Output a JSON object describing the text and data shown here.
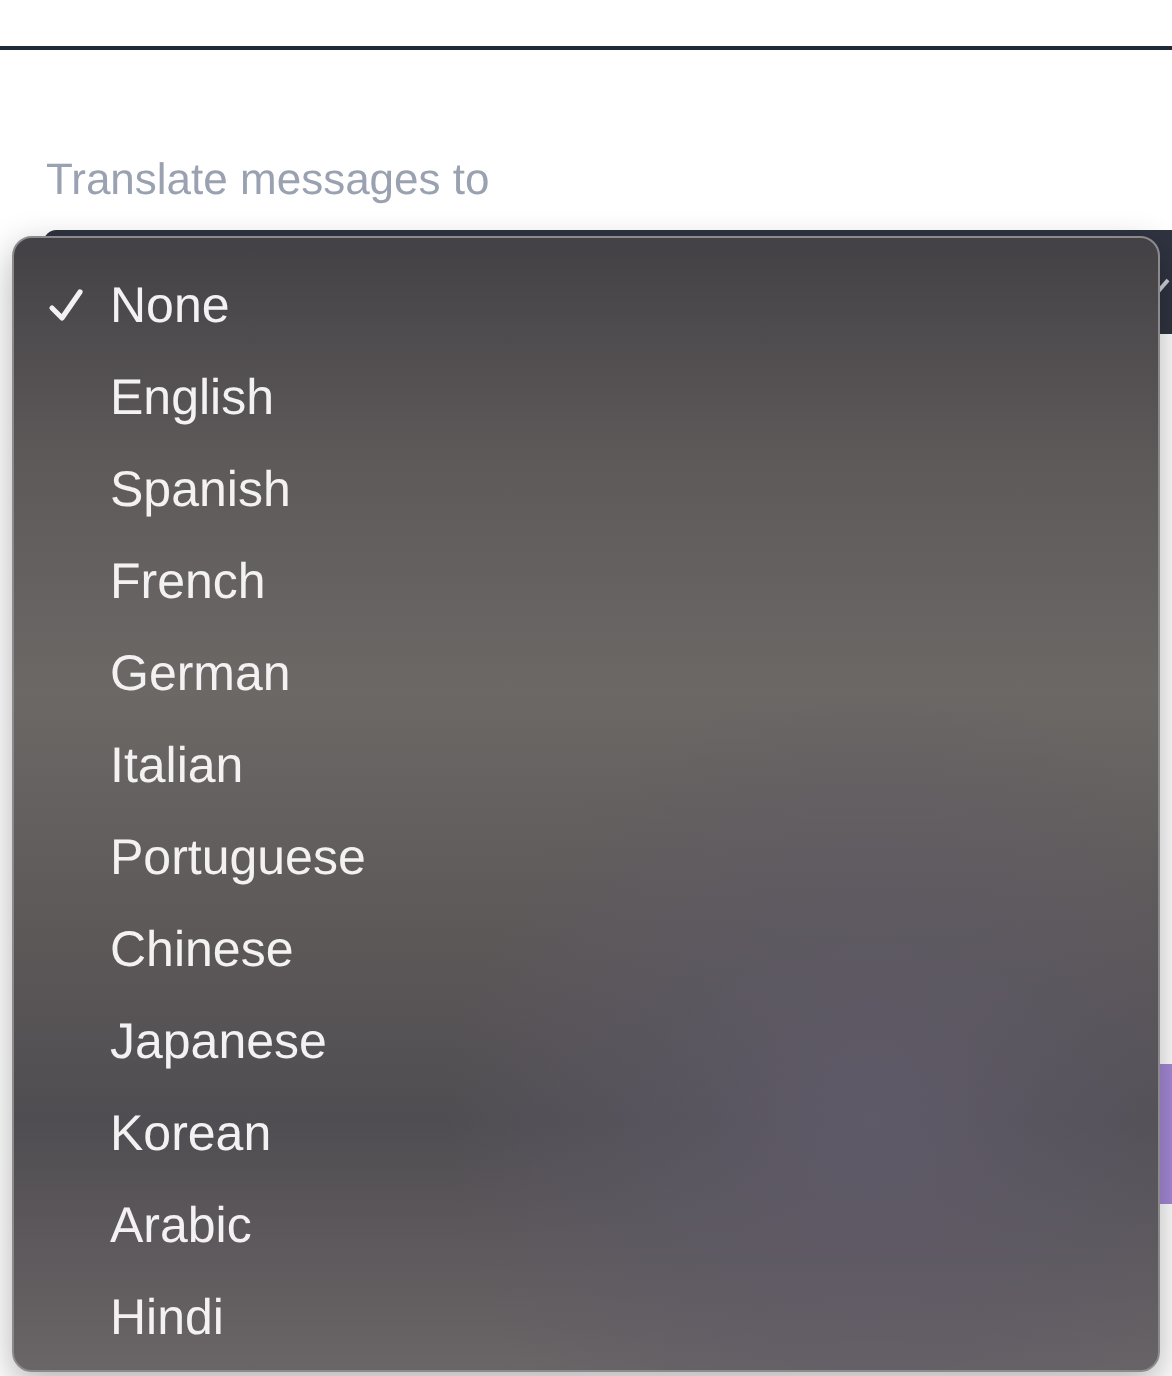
{
  "field": {
    "label": "Translate messages to"
  },
  "menu": {
    "options": [
      {
        "label": "None",
        "selected": true
      },
      {
        "label": "English",
        "selected": false
      },
      {
        "label": "Spanish",
        "selected": false
      },
      {
        "label": "French",
        "selected": false
      },
      {
        "label": "German",
        "selected": false
      },
      {
        "label": "Italian",
        "selected": false
      },
      {
        "label": "Portuguese",
        "selected": false
      },
      {
        "label": "Chinese",
        "selected": false
      },
      {
        "label": "Japanese",
        "selected": false
      },
      {
        "label": "Korean",
        "selected": false
      },
      {
        "label": "Arabic",
        "selected": false
      },
      {
        "label": "Hindi",
        "selected": false
      }
    ]
  }
}
